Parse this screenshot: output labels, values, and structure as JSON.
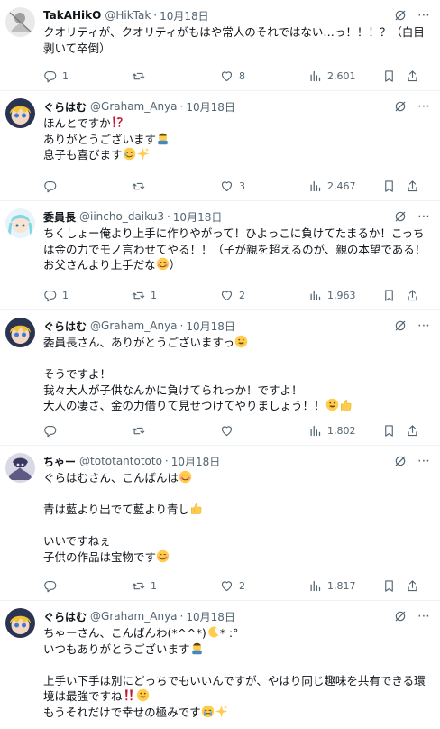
{
  "tweets": [
    {
      "name": "TakAHikO",
      "handle": "@HikTak",
      "date": "10月18日",
      "lines": [
        "クオリティが、クオリティがもはや常人のそれではない…っ！！！？（白目",
        "剥いて卒倒）"
      ],
      "reply": "1",
      "retweet": "",
      "like": "8",
      "views": "2,601"
    },
    {
      "name": "ぐらはむ",
      "handle": "@Graham_Anya",
      "date": "10月18日",
      "lines": [
        "ほんとですか",
        "ありがとうございます",
        "息子も喜びます"
      ],
      "reply": "",
      "retweet": "",
      "like": "3",
      "views": "2,467"
    },
    {
      "name": "委員長",
      "handle": "@iincho_daiku3",
      "date": "10月18日",
      "lines": [
        "ちくしょー俺より上手に作りやがって！ひよっこに負けてたまるか！こっち",
        "は金の力でモノ言わせてやる！！（子が親を超えるのが、親の本望である！",
        "お父さんより上手だな"
      ],
      "reply": "1",
      "retweet": "1",
      "like": "2",
      "views": "1,963"
    },
    {
      "name": "ぐらはむ",
      "handle": "@Graham_Anya",
      "date": "10月18日",
      "lines": [
        "委員長さん、ありがとうございますっ",
        "",
        "そうですよ！",
        "我々大人が子供なんかに負けてられっか！ですよ！",
        "大人の凄さ、金の力借りて見せつけてやりましょう！！"
      ],
      "reply": "",
      "retweet": "",
      "like": "",
      "views": "1,802"
    },
    {
      "name": "ちゃー",
      "handle": "@tototantototo",
      "date": "10月18日",
      "lines": [
        "ぐらはむさん、こんばんは",
        "",
        "青は藍より出でて藍より青し",
        "",
        "いいですねぇ",
        "子供の作品は宝物です"
      ],
      "reply": "",
      "retweet": "1",
      "like": "2",
      "views": "1,817"
    },
    {
      "name": "ぐらはむ",
      "handle": "@Graham_Anya",
      "date": "10月18日",
      "lines": [
        "ちゃーさん、こんばんわ(*^^*)",
        "いつもありがとうございます",
        "",
        "上手い下手は別にどっちでもいいんですが、やはり同じ趣味を共有できる環",
        "境は最強ですね",
        "もうそれだけで幸せの極みです"
      ],
      "reply": "",
      "retweet": "",
      "like": "",
      "views": ""
    }
  ],
  "icons": [
    "grok-icon",
    "more-icon",
    "reply-icon",
    "retweet-icon",
    "like-icon",
    "views-icon",
    "bookmark-icon",
    "share-icon"
  ],
  "colors": {
    "text": "#0f1419",
    "muted": "#536471",
    "border": "#eff3f4"
  }
}
